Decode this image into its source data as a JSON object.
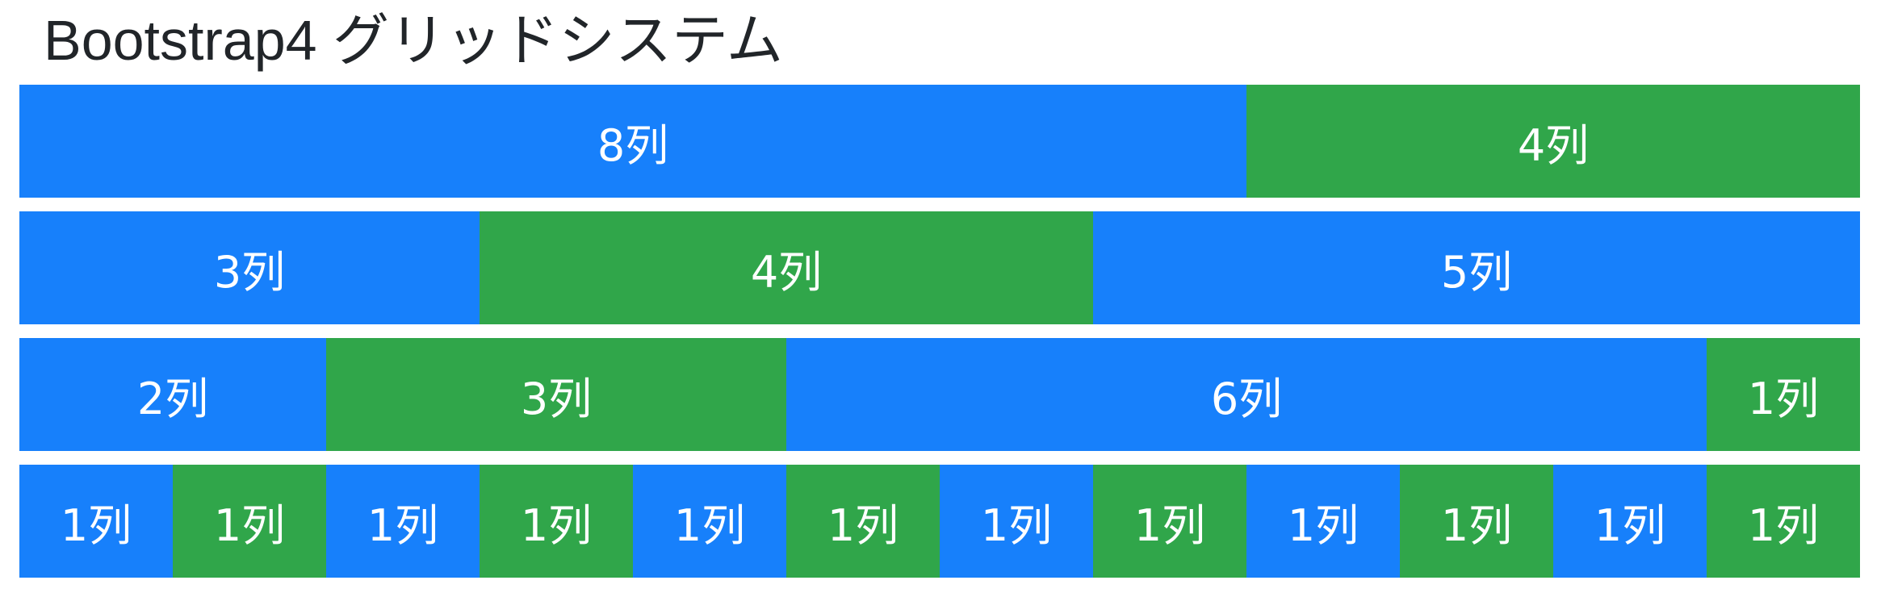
{
  "title": "Bootstrap4 グリッドシステム",
  "colors": {
    "primary": "#1780fb",
    "success": "#30a64a",
    "text": "#212529"
  },
  "rows": [
    {
      "cols": [
        {
          "span": 8,
          "label": "8列",
          "color": "primary"
        },
        {
          "span": 4,
          "label": "4列",
          "color": "success"
        }
      ]
    },
    {
      "cols": [
        {
          "span": 3,
          "label": "3列",
          "color": "primary"
        },
        {
          "span": 4,
          "label": "4列",
          "color": "success"
        },
        {
          "span": 5,
          "label": "5列",
          "color": "primary"
        }
      ]
    },
    {
      "cols": [
        {
          "span": 2,
          "label": "2列",
          "color": "primary"
        },
        {
          "span": 3,
          "label": "3列",
          "color": "success"
        },
        {
          "span": 6,
          "label": "6列",
          "color": "primary"
        },
        {
          "span": 1,
          "label": "1列",
          "color": "success"
        }
      ]
    },
    {
      "cols": [
        {
          "span": 1,
          "label": "1列",
          "color": "primary"
        },
        {
          "span": 1,
          "label": "1列",
          "color": "success"
        },
        {
          "span": 1,
          "label": "1列",
          "color": "primary"
        },
        {
          "span": 1,
          "label": "1列",
          "color": "success"
        },
        {
          "span": 1,
          "label": "1列",
          "color": "primary"
        },
        {
          "span": 1,
          "label": "1列",
          "color": "success"
        },
        {
          "span": 1,
          "label": "1列",
          "color": "primary"
        },
        {
          "span": 1,
          "label": "1列",
          "color": "success"
        },
        {
          "span": 1,
          "label": "1列",
          "color": "primary"
        },
        {
          "span": 1,
          "label": "1列",
          "color": "success"
        },
        {
          "span": 1,
          "label": "1列",
          "color": "primary"
        },
        {
          "span": 1,
          "label": "1列",
          "color": "success"
        }
      ]
    }
  ]
}
